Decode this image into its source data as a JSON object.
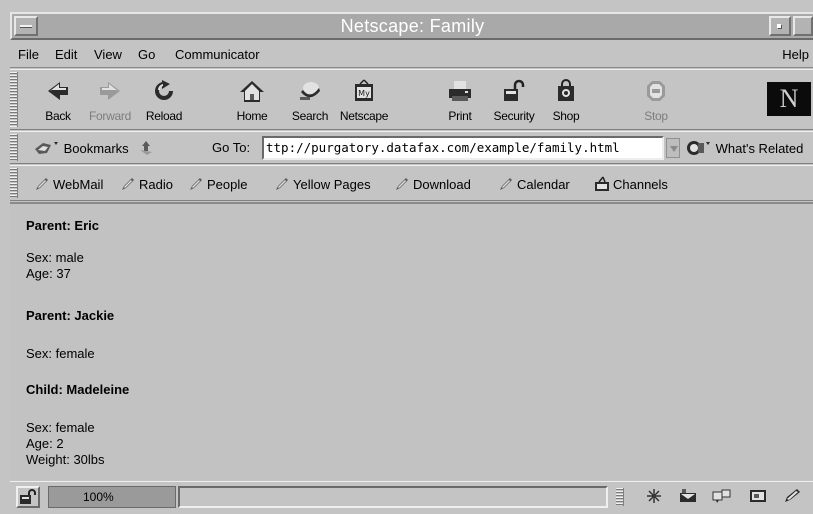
{
  "window": {
    "title": "Netscape: Family"
  },
  "menubar": {
    "items": [
      "File",
      "Edit",
      "View",
      "Go",
      "Communicator"
    ],
    "help": "Help"
  },
  "nav_toolbar": {
    "buttons": [
      {
        "label": "Back",
        "icon": "back-arrow-icon",
        "enabled": true
      },
      {
        "label": "Forward",
        "icon": "forward-arrow-icon",
        "enabled": false
      },
      {
        "label": "Reload",
        "icon": "reload-icon",
        "enabled": true
      },
      {
        "label": "Home",
        "icon": "home-icon",
        "enabled": true
      },
      {
        "label": "Search",
        "icon": "search-icon",
        "enabled": true
      },
      {
        "label": "Netscape",
        "icon": "my-netscape-icon",
        "enabled": true
      },
      {
        "label": "Print",
        "icon": "printer-icon",
        "enabled": true
      },
      {
        "label": "Security",
        "icon": "padlock-icon",
        "enabled": true
      },
      {
        "label": "Shop",
        "icon": "shopping-bag-icon",
        "enabled": true
      },
      {
        "label": "Stop",
        "icon": "stop-icon",
        "enabled": false
      }
    ],
    "logo": "N"
  },
  "location_toolbar": {
    "bookmarks_label": "Bookmarks",
    "goto_label": "Go To:",
    "url": "ttp://purgatory.datafax.com/example/family.html",
    "whats_related": "What's Related"
  },
  "personal_toolbar": {
    "links": [
      "WebMail",
      "Radio",
      "People",
      "Yellow Pages",
      "Download",
      "Calendar",
      "Channels"
    ]
  },
  "content": {
    "parent1_heading": "Parent: Eric",
    "parent1_sex": "Sex: male",
    "parent1_age": "Age: 37",
    "parent2_heading": "Parent: Jackie",
    "parent2_sex": "Sex: female",
    "child_heading": "Child: Madeleine",
    "child_sex": "Sex: female",
    "child_age": "Age: 2",
    "child_weight": "Weight: 30lbs"
  },
  "statusbar": {
    "progress": "100%"
  }
}
